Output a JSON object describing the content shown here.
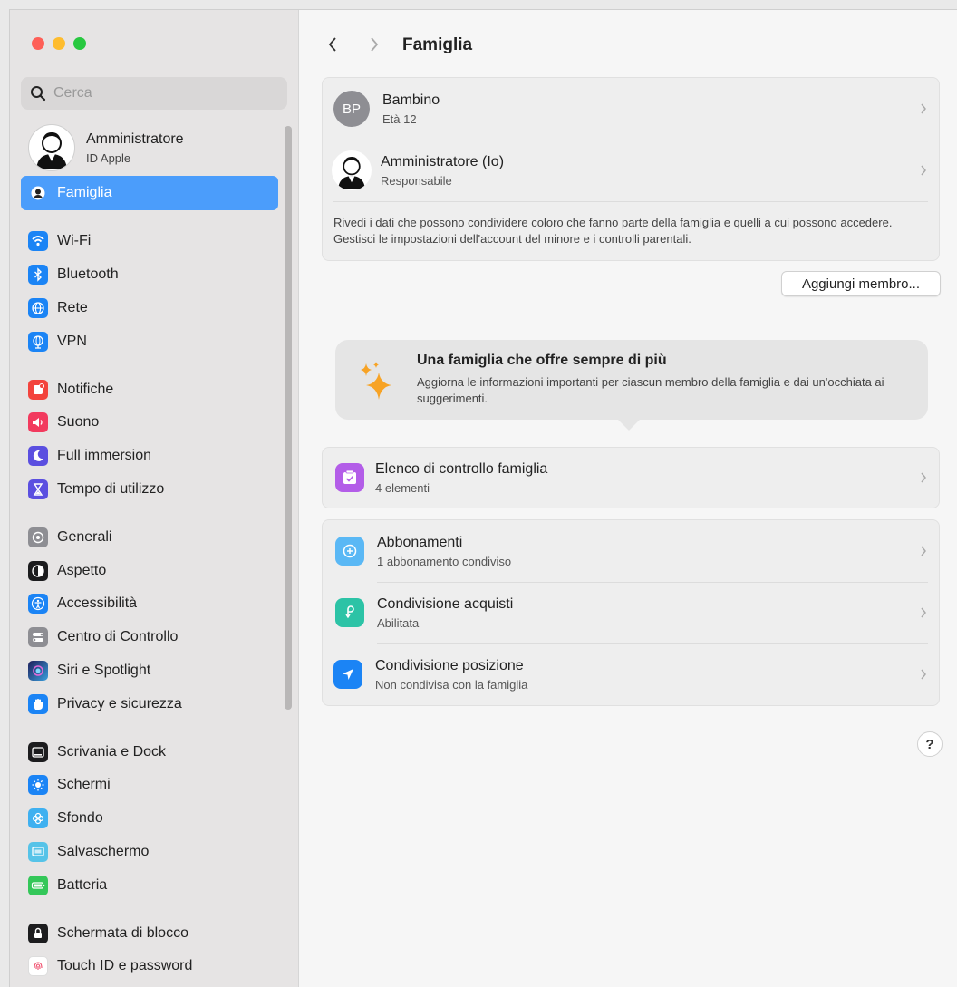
{
  "window": {
    "traffic": [
      "close",
      "minimize",
      "zoom"
    ]
  },
  "search": {
    "placeholder": "Cerca"
  },
  "account": {
    "name": "Amministratore",
    "sub": "ID Apple"
  },
  "sidebar": {
    "active": "Famiglia",
    "items": [
      {
        "label": "Famiglia",
        "icon": "family-icon",
        "color": "#4b9dfb"
      },
      {
        "label": "Wi-Fi",
        "icon": "wifi-icon",
        "color": "#1b84f5"
      },
      {
        "label": "Bluetooth",
        "icon": "bluetooth-icon",
        "color": "#1b84f5"
      },
      {
        "label": "Rete",
        "icon": "globe-icon",
        "color": "#1b84f5"
      },
      {
        "label": "VPN",
        "icon": "vpn-globe-icon",
        "color": "#1b84f5"
      },
      {
        "label": "Notifiche",
        "icon": "bell-icon",
        "color": "#f3433c"
      },
      {
        "label": "Suono",
        "icon": "speaker-icon",
        "color": "#f23a5e"
      },
      {
        "label": "Full immersion",
        "icon": "moon-icon",
        "color": "#5b4fe0"
      },
      {
        "label": "Tempo di utilizzo",
        "icon": "hourglass-icon",
        "color": "#5b4fe0"
      },
      {
        "label": "Generali",
        "icon": "gear-icon",
        "color": "#8e8e93"
      },
      {
        "label": "Aspetto",
        "icon": "appearance-icon",
        "color": "#1c1c1e"
      },
      {
        "label": "Accessibilità",
        "icon": "accessibility-icon",
        "color": "#1b84f5"
      },
      {
        "label": "Centro di Controllo",
        "icon": "control-center-icon",
        "color": "#8e8e93"
      },
      {
        "label": "Siri e Spotlight",
        "icon": "siri-icon",
        "color": "#3a3a9e"
      },
      {
        "label": "Privacy e sicurezza",
        "icon": "hand-icon",
        "color": "#1b84f5"
      },
      {
        "label": "Scrivania e Dock",
        "icon": "dock-icon",
        "color": "#1c1c1e"
      },
      {
        "label": "Schermi",
        "icon": "display-icon",
        "color": "#1b84f5"
      },
      {
        "label": "Sfondo",
        "icon": "wallpaper-icon",
        "color": "#3fb0f0"
      },
      {
        "label": "Salvaschermo",
        "icon": "screensaver-icon",
        "color": "#56c3e8"
      },
      {
        "label": "Batteria",
        "icon": "battery-icon",
        "color": "#34c759"
      },
      {
        "label": "Schermata di blocco",
        "icon": "lock-icon",
        "color": "#1c1c1e"
      },
      {
        "label": "Touch ID e password",
        "icon": "fingerprint-icon",
        "color": "#ffffff"
      }
    ]
  },
  "main": {
    "title": "Famiglia",
    "members": [
      {
        "initials": "BP",
        "name": "Bambino",
        "sub": "Età 12"
      },
      {
        "name": "Amministratore (Io)",
        "sub": "Responsabile"
      }
    ],
    "members_desc": "Rivedi i dati che possono condividere coloro che fanno parte della famiglia e quelli a cui possono accedere. Gestisci le impostazioni dell'account del minore e i controlli parentali.",
    "add_member": "Aggiungi membro...",
    "tip": {
      "title": "Una famiglia che offre sempre di più",
      "desc": "Aggiorna le informazioni importanti per ciascun membro della famiglia e dai un'occhiata ai suggerimenti."
    },
    "checklist": {
      "title": "Elenco di controllo famiglia",
      "sub": "4 elementi",
      "color": "#b35de8"
    },
    "services": [
      {
        "title": "Abbonamenti",
        "sub": "1 abbonamento condiviso",
        "color": "#5ab8f5"
      },
      {
        "title": "Condivisione acquisti",
        "sub": "Abilitata",
        "color": "#2cc3a6"
      },
      {
        "title": "Condivisione posizione",
        "sub": "Non condivisa con la famiglia",
        "color": "#1b84f5"
      }
    ],
    "help": "?"
  }
}
